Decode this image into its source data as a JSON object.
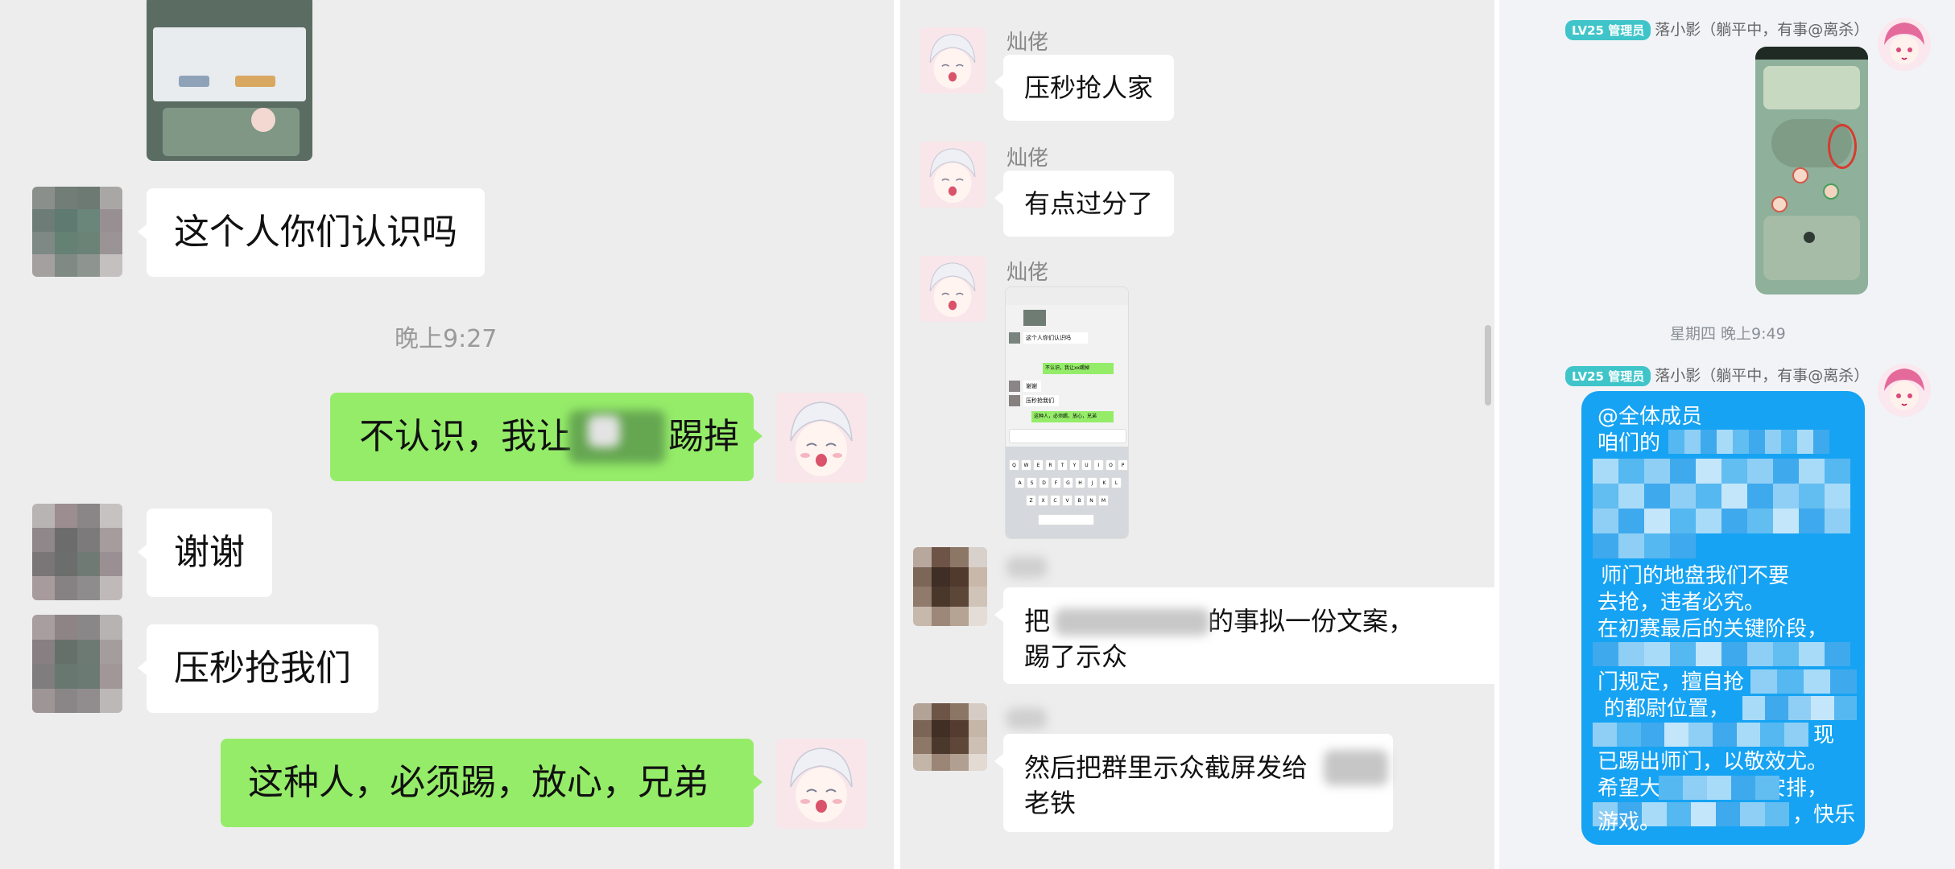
{
  "panel1": {
    "messages": [
      {
        "side": "left",
        "text": "这个人你们认识吗"
      },
      {
        "side": "right",
        "text_before": "不认识，我让",
        "text_after": "踢掉"
      },
      {
        "side": "left",
        "text": "谢谢"
      },
      {
        "side": "left",
        "text": "压秒抢我们"
      },
      {
        "side": "right",
        "text": "这种人，必须踢，放心，兄弟"
      }
    ],
    "timestamp": "晚上9:27"
  },
  "panel2": {
    "sender_name": "灿佬",
    "messages": [
      {
        "text": "压秒抢人家"
      },
      {
        "text": "有点过分了"
      },
      {
        "text_before": "把",
        "text_after": "的事拟一份文案，",
        "text_line2": "踢了示众"
      },
      {
        "text_before": "然后把群里示众截屏发给",
        "text_line2": "老铁"
      }
    ],
    "thumb": {
      "msg1": "这个人你们认识吗",
      "msg2": "不认识，我让xx踢掉",
      "msg3": "谢谢",
      "msg4": "压秒抢我们",
      "msg5": "这种人，必须踢，放心，兄弟",
      "keys_row1": [
        "Q",
        "W",
        "E",
        "R",
        "T",
        "Y",
        "U",
        "I",
        "O",
        "P"
      ],
      "keys_row2": [
        "A",
        "S",
        "D",
        "F",
        "G",
        "H",
        "J",
        "K",
        "L"
      ],
      "keys_row3": [
        "Z",
        "X",
        "C",
        "V",
        "B",
        "N",
        "M"
      ]
    }
  },
  "panel3": {
    "badge": "LV25 管理员",
    "sender": "落小影（躺平中，有事@离杀）",
    "timestamp": "星期四 晚上9:49",
    "bubble_lines": [
      "@全体成员",
      "咱们的",
      "",
      "",
      "",
      "师门的地盘我们不要",
      "去抢，违者必究。",
      "在初赛最后的关键阶段，",
      "",
      "门规定，擅自抢",
      "的都尉位置，",
      "现",
      "已踢出师门，以敬效尤。",
      "希望大家听从师门安排，",
      "，快乐",
      "游戏。"
    ]
  },
  "colors": {
    "wechat_bg": "#ededed",
    "green_bubble": "#95ec69",
    "blue_bubble": "#16a3f3",
    "badge_teal": "#3fc5c9"
  }
}
